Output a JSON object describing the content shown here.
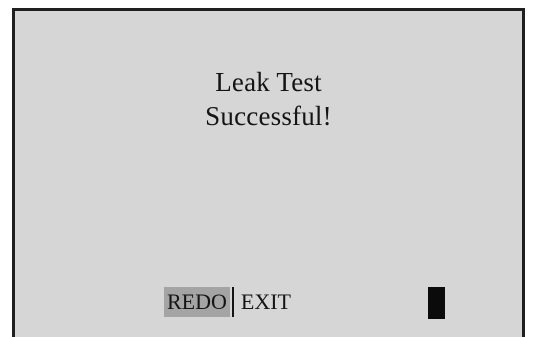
{
  "message": {
    "line1": "Leak Test",
    "line2": "Successful!"
  },
  "softkeys": {
    "redo_label": "REDO",
    "exit_label": "EXIT",
    "selected": "REDO"
  },
  "colors": {
    "screen_background": "#d6d6d6",
    "selected_highlight": "#a4a4a4",
    "text": "#141414",
    "frame": "#1f1f1f"
  }
}
